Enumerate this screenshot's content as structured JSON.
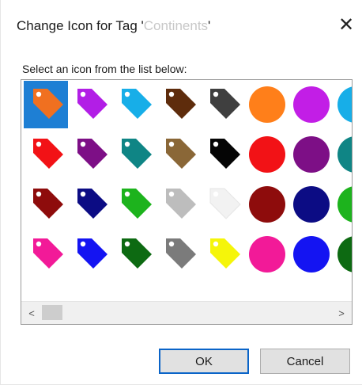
{
  "dialog": {
    "title_prefix": "Change Icon for Tag ",
    "quote_open": "'",
    "tag_name": "Continents",
    "quote_close": "'",
    "close_glyph": "✕",
    "instruction": "Select an icon from the list below:",
    "ok_label": "OK",
    "cancel_label": "Cancel"
  },
  "icon_grid": {
    "selected_index": 0,
    "rows": [
      [
        {
          "shape": "tag",
          "color": "#f07020"
        },
        {
          "shape": "tag",
          "color": "#b21ee6"
        },
        {
          "shape": "tag",
          "color": "#17aee8"
        },
        {
          "shape": "tag",
          "color": "#5e2c0c"
        },
        {
          "shape": "tag",
          "color": "#3f3f3f"
        },
        {
          "shape": "circle",
          "color": "#ff7f1a"
        },
        {
          "shape": "circle",
          "color": "#c21ee6"
        },
        {
          "shape": "circle",
          "color": "#17aee8"
        }
      ],
      [
        {
          "shape": "tag",
          "color": "#f21216"
        },
        {
          "shape": "tag",
          "color": "#7d0f86"
        },
        {
          "shape": "tag",
          "color": "#0f8585"
        },
        {
          "shape": "tag",
          "color": "#8a6737"
        },
        {
          "shape": "tag",
          "color": "#050505"
        },
        {
          "shape": "circle",
          "color": "#f21216"
        },
        {
          "shape": "circle",
          "color": "#7d0f86"
        },
        {
          "shape": "circle",
          "color": "#0f8585"
        }
      ],
      [
        {
          "shape": "tag",
          "color": "#8e0c0c"
        },
        {
          "shape": "tag",
          "color": "#0c0c84"
        },
        {
          "shape": "tag",
          "color": "#1db31d"
        },
        {
          "shape": "tag",
          "color": "#bdbdbd"
        },
        {
          "shape": "tag",
          "color": "#f2f2f2"
        },
        {
          "shape": "circle",
          "color": "#8e0c0c"
        },
        {
          "shape": "circle",
          "color": "#0c0c84"
        },
        {
          "shape": "circle",
          "color": "#1db31d"
        }
      ],
      [
        {
          "shape": "tag",
          "color": "#f21a98"
        },
        {
          "shape": "tag",
          "color": "#1414f2"
        },
        {
          "shape": "tag",
          "color": "#0d6a12"
        },
        {
          "shape": "tag",
          "color": "#7b7b7b"
        },
        {
          "shape": "tag",
          "color": "#f5f50a"
        },
        {
          "shape": "circle",
          "color": "#f21a98"
        },
        {
          "shape": "circle",
          "color": "#1414f2"
        },
        {
          "shape": "circle",
          "color": "#0d6a12"
        }
      ]
    ]
  },
  "scrollbar": {
    "left_arrow": "<",
    "right_arrow": ">"
  },
  "icons": {
    "close": "close-icon",
    "scroll_left": "chevron-left-icon",
    "scroll_right": "chevron-right-icon"
  }
}
